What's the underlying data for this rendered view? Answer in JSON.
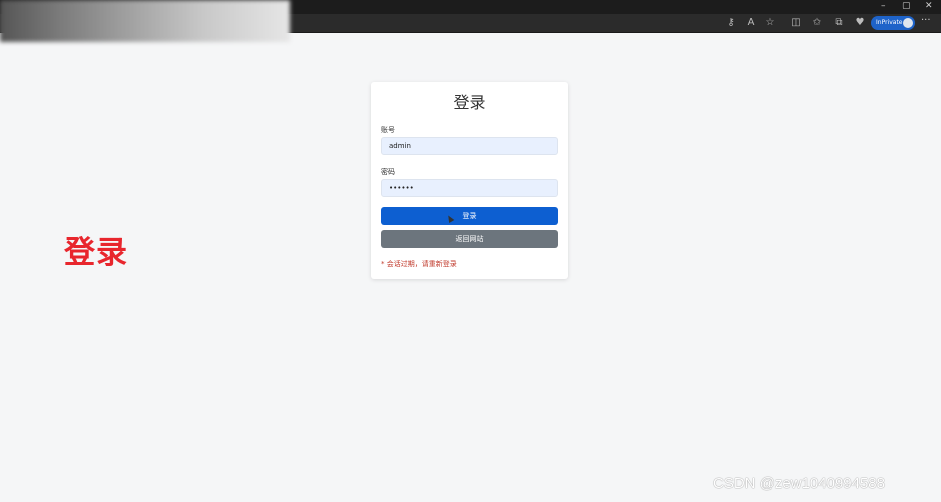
{
  "browser": {
    "window_controls": [
      "–",
      "▢",
      "✕"
    ],
    "inprivate_label": "InPrivate",
    "more_label": "···"
  },
  "page": {
    "side_title": "登录"
  },
  "login_card": {
    "title": "登录",
    "account_label": "账号",
    "account_value": "admin",
    "password_label": "密码",
    "password_value": "••••••",
    "login_button": "登录",
    "back_button": "返回网站",
    "error_message": "* 会话过期，请重新登录"
  },
  "watermark": "CSDN @zew1040994588",
  "colors": {
    "primary": "#0d5fd1",
    "secondary": "#6c757d",
    "danger": "#e8262d",
    "error_text": "#c0392b",
    "input_bg": "#e8f0fe"
  }
}
